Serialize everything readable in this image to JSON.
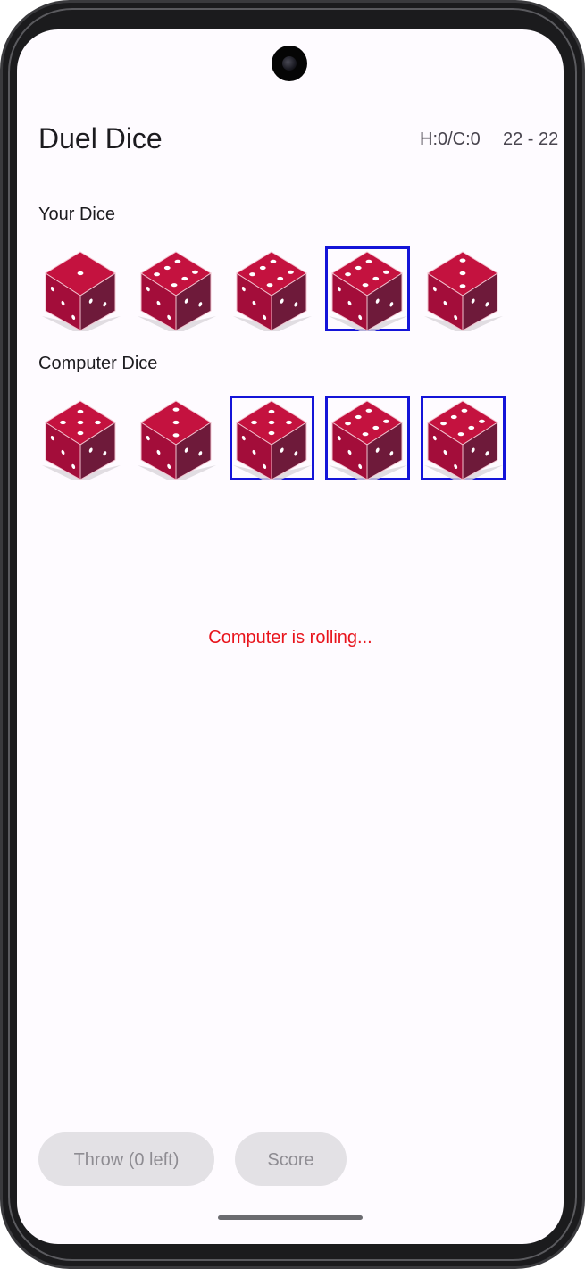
{
  "app": {
    "title": "Duel Dice",
    "score_hc": "H:0/C:0",
    "score_totals": "22 - 22"
  },
  "player": {
    "label": "Your Dice",
    "dice": [
      {
        "value": 1,
        "held": false
      },
      {
        "value": 6,
        "held": false
      },
      {
        "value": 6,
        "held": false
      },
      {
        "value": 6,
        "held": true
      },
      {
        "value": 3,
        "held": false
      }
    ]
  },
  "computer": {
    "label": "Computer Dice",
    "dice": [
      {
        "value": 5,
        "held": false
      },
      {
        "value": 3,
        "held": false
      },
      {
        "value": 5,
        "held": true
      },
      {
        "value": 6,
        "held": true
      },
      {
        "value": 6,
        "held": true
      }
    ]
  },
  "status": {
    "message": "Computer is rolling...",
    "color": "#e8141c"
  },
  "actions": {
    "throw_label": "Throw (0 left)",
    "score_label": "Score"
  },
  "colors": {
    "die_top": "#c4123f",
    "die_left": "#a30d3a",
    "die_right": "#6e1a3a",
    "held_border": "#1414d8",
    "background": "#fefbff"
  }
}
